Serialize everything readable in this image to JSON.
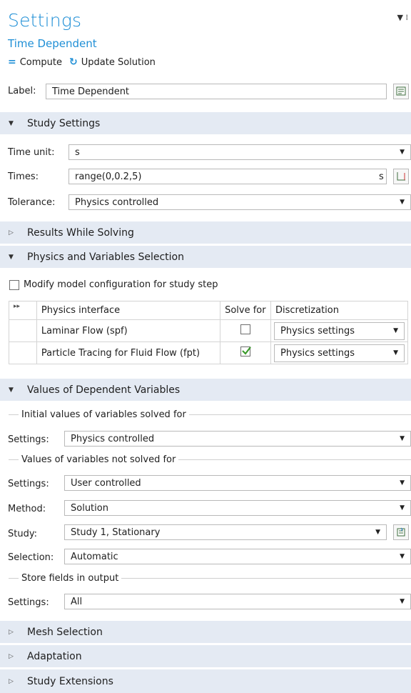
{
  "header": {
    "title": "Settings",
    "subtitle": "Time Dependent",
    "compute_label": "Compute",
    "update_label": "Update Solution"
  },
  "label_row": {
    "label": "Label:",
    "value": "Time Dependent"
  },
  "study_settings": {
    "heading": "Study Settings",
    "time_unit_label": "Time unit:",
    "time_unit_value": "s",
    "times_label": "Times:",
    "times_value": "range(0,0.2,5)",
    "times_unit": "s",
    "tolerance_label": "Tolerance:",
    "tolerance_value": "Physics controlled"
  },
  "results_while_solving": {
    "heading": "Results While Solving"
  },
  "physics_selection": {
    "heading": "Physics and Variables Selection",
    "modify_label": "Modify model configuration for study step",
    "modify_checked": false,
    "columns": [
      "Physics interface",
      "Solve for",
      "Discretization"
    ],
    "rows": [
      {
        "name": "Laminar Flow (spf)",
        "solve": false,
        "discretization": "Physics settings"
      },
      {
        "name": "Particle Tracing for Fluid Flow (fpt)",
        "solve": true,
        "discretization": "Physics settings"
      }
    ]
  },
  "dependent_vars": {
    "heading": "Values of Dependent Variables",
    "initial_group": "Initial values of variables solved for",
    "initial_settings_label": "Settings:",
    "initial_settings_value": "Physics controlled",
    "notsolved_group": "Values of variables not solved for",
    "notsolved_settings_label": "Settings:",
    "notsolved_settings_value": "User controlled",
    "method_label": "Method:",
    "method_value": "Solution",
    "study_label": "Study:",
    "study_value": "Study 1, Stationary",
    "selection_label": "Selection:",
    "selection_value": "Automatic",
    "store_group": "Store fields in output",
    "store_settings_label": "Settings:",
    "store_settings_value": "All"
  },
  "collapsed_sections": {
    "mesh": "Mesh Selection",
    "adaptation": "Adaptation",
    "extensions": "Study Extensions"
  },
  "colors": {
    "accent": "#1f8fd6",
    "section_bg": "#e4eaf3",
    "check": "#3a9a2a"
  }
}
